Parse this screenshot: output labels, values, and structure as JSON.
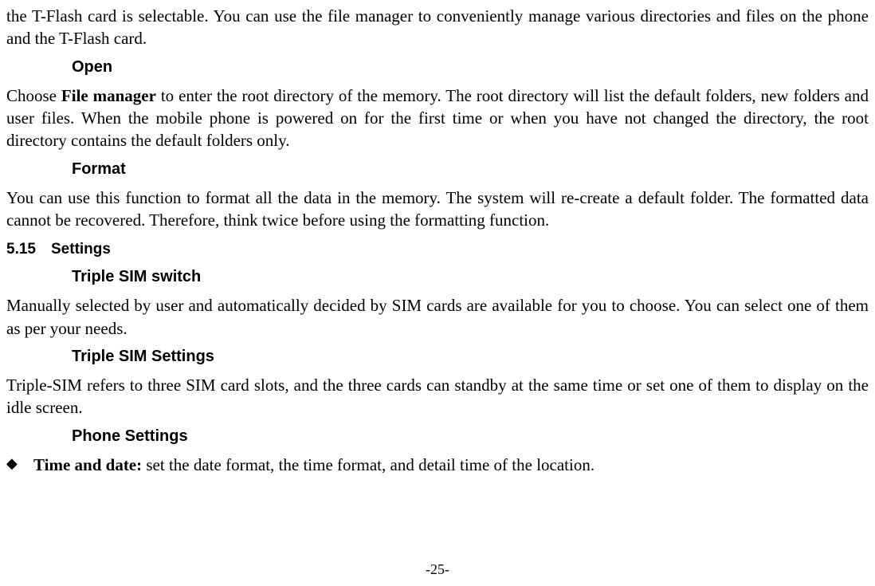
{
  "intro_para": "the T-Flash card is selectable. You can use the file manager to conveniently manage various directories and files on the phone and the T-Flash card.",
  "open": {
    "heading": "Open",
    "text_pre": "Choose ",
    "text_bold": "File manager",
    "text_post": " to enter the root directory of the memory. The root directory will list the default folders, new folders and user files. When the mobile phone is powered on for the first time or when you have not changed the directory, the root directory contains the default folders only."
  },
  "format": {
    "heading": "Format",
    "text": "You can use this function to format all the data in the memory. The system will re-create a default folder. The formatted data cannot be recovered. Therefore, think twice before using the formatting function."
  },
  "settings": {
    "num": "5.15",
    "heading": "Settings",
    "triple_switch": {
      "heading": "Triple SIM switch",
      "text": "Manually selected by user and automatically decided by SIM cards are available for you to choose. You can select one of them as per your needs."
    },
    "triple_settings": {
      "heading": "Triple SIM Settings",
      "text": "Triple-SIM refers to three SIM card slots, and the three cards can standby at the same time or set one of them to display on the idle screen."
    },
    "phone_settings": {
      "heading": "Phone Settings",
      "bullet": {
        "sym": "◆",
        "bold": "Time and date:",
        "rest": " set the date format, the time format, and detail time of the location."
      }
    }
  },
  "page_number": "-25-"
}
